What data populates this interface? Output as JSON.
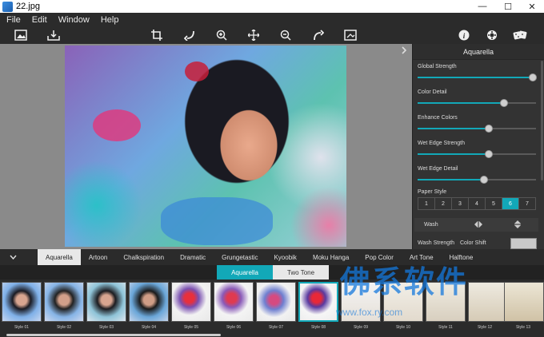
{
  "window": {
    "title": "22.jpg",
    "minimize": "—",
    "maximize": "☐",
    "close": "✕"
  },
  "menu": [
    "File",
    "Edit",
    "Window",
    "Help"
  ],
  "toolbar": {
    "icons": [
      "image-open-icon",
      "save-icon",
      "crop-icon",
      "undo-icon",
      "zoom-in-icon",
      "move-icon",
      "zoom-out-icon",
      "redo-icon",
      "fit-view-icon",
      "info-icon",
      "settings-icon",
      "dice-icon"
    ]
  },
  "panel": {
    "title": "Aquarella",
    "sliders": [
      {
        "label": "Global Strength",
        "value": 0.97
      },
      {
        "label": "Color Detail",
        "value": 0.73
      },
      {
        "label": "Enhance Colors",
        "value": 0.6
      },
      {
        "label": "Wet Edge Strength",
        "value": 0.6
      },
      {
        "label": "Wet Edge Detail",
        "value": 0.56
      }
    ],
    "paper_style_label": "Paper Style",
    "paper_styles": [
      "1",
      "2",
      "3",
      "4",
      "5",
      "6",
      "7"
    ],
    "paper_style_selected": "6",
    "wash_label": "Wash",
    "wash_strength_label": "Wash Strength",
    "color_shift_label": "Color Shift"
  },
  "style_tabs": [
    "Aquarella",
    "Artoon",
    "Chalkspiration",
    "Dramatic",
    "Grungetastic",
    "Kyoobik",
    "Moku Hanga",
    "Pop Color",
    "Art Tone",
    "Halftone"
  ],
  "style_tab_selected": "Aquarella",
  "subtabs": [
    "Aquarella",
    "Two Tone"
  ],
  "thumbnails": [
    "Style 01",
    "Style 02",
    "Style 03",
    "Style 04",
    "Style 05",
    "Style 06",
    "Style 07",
    "Style 08",
    "Style 09",
    "Style 10",
    "Style 11",
    "Style 12",
    "Style 13"
  ],
  "thumbnail_selected": "Style 08",
  "watermark": {
    "main": "佛系软件",
    "url": "www.fox.ry.com"
  },
  "colors": {
    "accent": "#12a8b8",
    "bg": "#2b2b2b"
  }
}
